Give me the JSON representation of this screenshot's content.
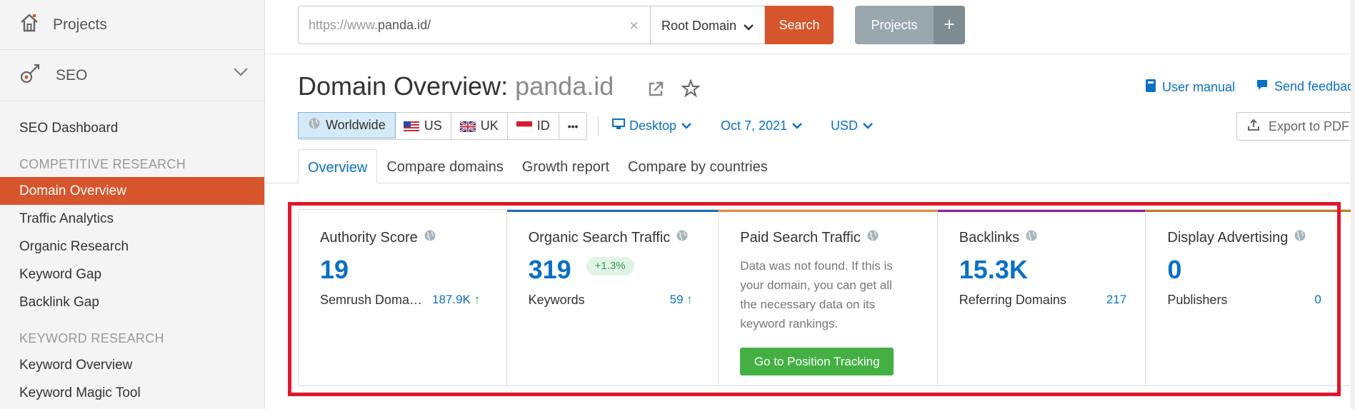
{
  "sidebar": {
    "projects_label": "Projects",
    "seo_label": "SEO",
    "items": [
      {
        "type": "item",
        "label": "SEO Dashboard",
        "active": false
      },
      {
        "type": "head",
        "label": "COMPETITIVE RESEARCH"
      },
      {
        "type": "item",
        "label": "Domain Overview",
        "active": true
      },
      {
        "type": "item",
        "label": "Traffic Analytics",
        "active": false
      },
      {
        "type": "item",
        "label": "Organic Research",
        "active": false
      },
      {
        "type": "item",
        "label": "Keyword Gap",
        "active": false
      },
      {
        "type": "item",
        "label": "Backlink Gap",
        "active": false
      },
      {
        "type": "head",
        "label": "KEYWORD RESEARCH"
      },
      {
        "type": "item",
        "label": "Keyword Overview",
        "active": false
      },
      {
        "type": "item",
        "label": "Keyword Magic Tool",
        "active": false
      }
    ]
  },
  "topbar": {
    "search_prefix": "https://www.",
    "search_domain": "panda.id/",
    "clear_icon": "×",
    "scope": "Root Domain",
    "search_label": "Search",
    "projects_label": "Projects",
    "plus_label": "+"
  },
  "header": {
    "title_prefix": "Domain Overview:",
    "title_domain": "panda.id",
    "user_manual": "User manual",
    "send_feedback": "Send feedback"
  },
  "filters": {
    "regions": [
      {
        "label": "Worldwide",
        "icon": "globe-icon",
        "selected": true
      },
      {
        "label": "US",
        "icon": "us-flag-icon",
        "selected": false
      },
      {
        "label": "UK",
        "icon": "uk-flag-icon",
        "selected": false
      },
      {
        "label": "ID",
        "icon": "id-flag-icon",
        "selected": false
      },
      {
        "label": "•••",
        "icon": "more-icon",
        "selected": false
      }
    ],
    "device": "Desktop",
    "date": "Oct 7, 2021",
    "currency": "USD",
    "export": "Export to PDF"
  },
  "tabs": [
    {
      "label": "Overview",
      "active": true
    },
    {
      "label": "Compare domains",
      "active": false
    },
    {
      "label": "Growth report",
      "active": false
    },
    {
      "label": "Compare by countries",
      "active": false
    }
  ],
  "cards": {
    "authority": {
      "title": "Authority Score",
      "value": "19",
      "sub_label": "Semrush Doma…",
      "sub_value": "187.9K"
    },
    "organic": {
      "title": "Organic Search Traffic",
      "value": "319",
      "badge": "+1.3%",
      "sub_label": "Keywords",
      "sub_value": "59"
    },
    "paid": {
      "title": "Paid Search Traffic",
      "desc": "Data was not found. If this is your domain, you can get all the necessary data on its keyword rankings.",
      "button": "Go to Position Tracking"
    },
    "backlinks": {
      "title": "Backlinks",
      "value": "15.3K",
      "sub_label": "Referring Domains",
      "sub_value": "217"
    },
    "display": {
      "title": "Display Advertising",
      "value": "0",
      "sub_label": "Publishers",
      "sub_value": "0"
    }
  },
  "colors": {
    "accent": "#d7552c",
    "link": "#0a70c4",
    "highlight": "#e0162b",
    "green": "#44b043",
    "organic_top": "#1a6fc4",
    "paid_top": "#e8883a",
    "backlinks_top": "#8e1e9e",
    "display_top": "#c77a2a"
  }
}
